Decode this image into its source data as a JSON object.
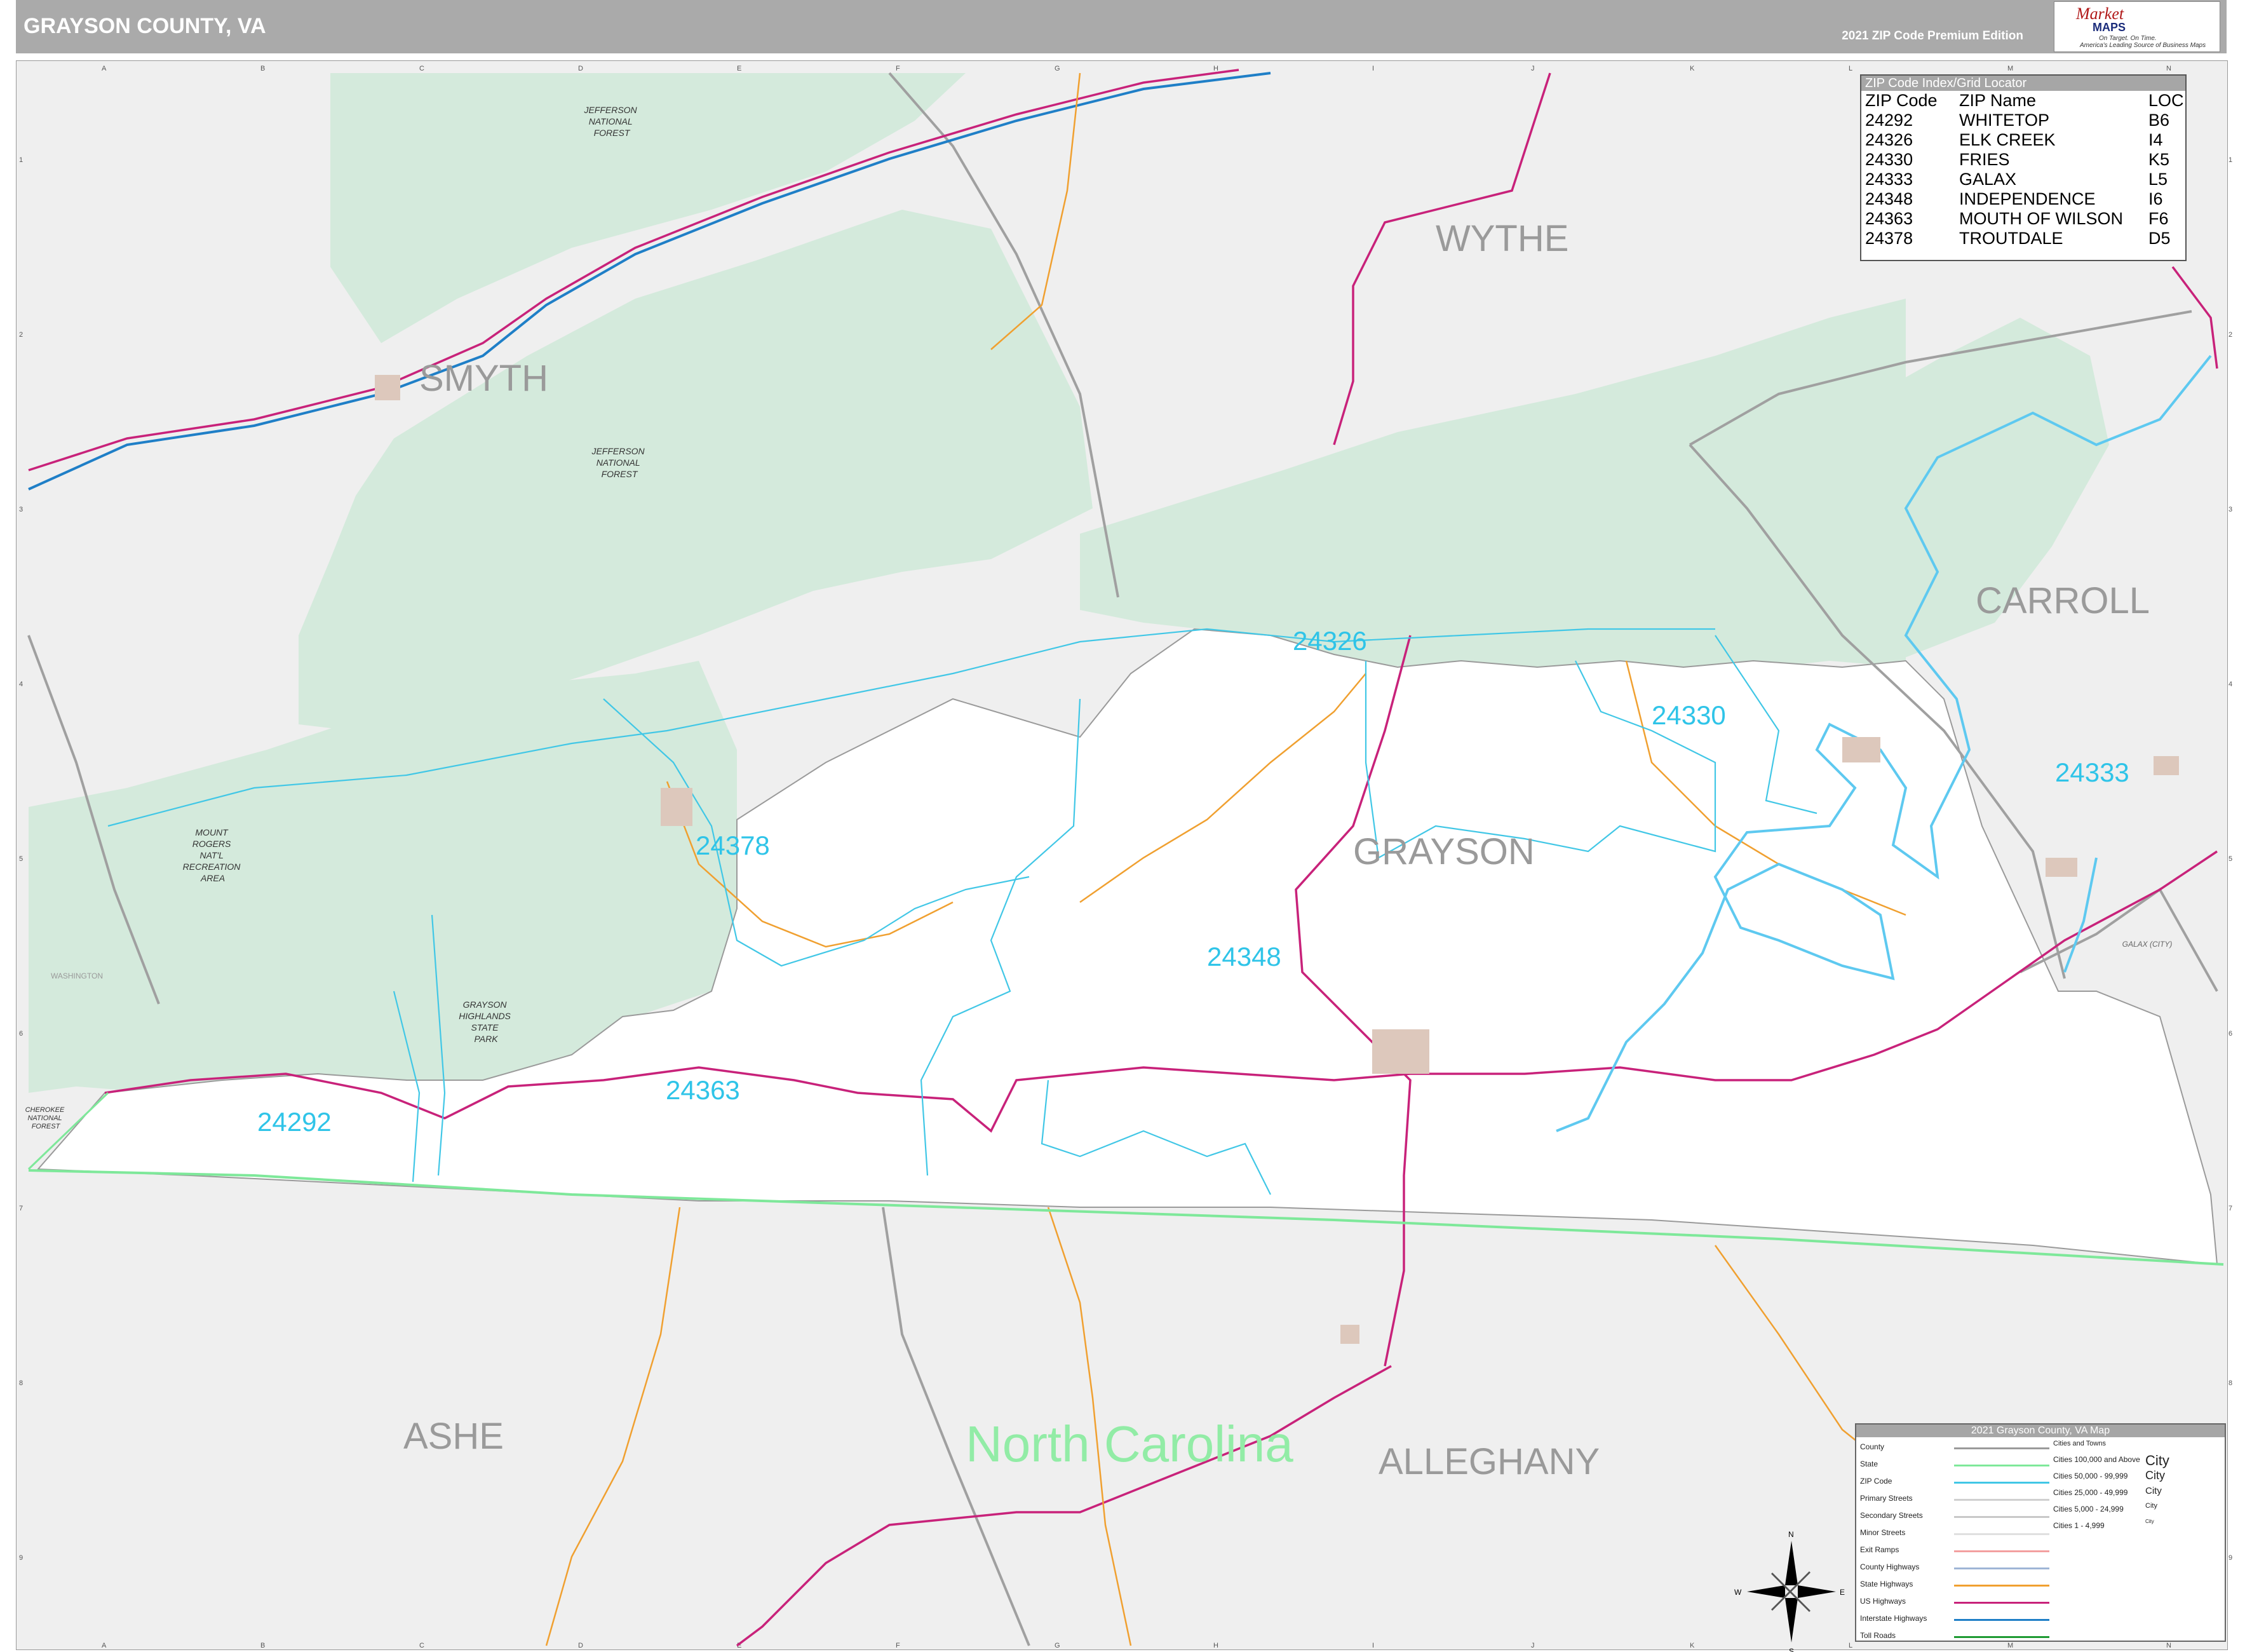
{
  "header": {
    "title": "GRAYSON COUNTY, VA",
    "edition": "2021 ZIP Code Premium Edition",
    "logo": {
      "brand_top": "Market",
      "brand_bottom": "MAPS",
      "tagline_1": "On Target. On Time.",
      "tagline_2": "America's Leading Source of Business Maps"
    }
  },
  "grid": {
    "columns": [
      "A",
      "B",
      "C",
      "D",
      "E",
      "F",
      "G",
      "H",
      "I",
      "J",
      "K",
      "L",
      "M",
      "N"
    ],
    "rows": [
      "1",
      "2",
      "3",
      "4",
      "5",
      "6",
      "7",
      "8",
      "9"
    ]
  },
  "zip_index": {
    "title": "ZIP Code Index/Grid Locator",
    "columns": [
      "ZIP Code",
      "ZIP Name",
      "LOC"
    ],
    "rows": [
      [
        "24292",
        "WHITETOP",
        "B6"
      ],
      [
        "24326",
        "ELK CREEK",
        "I4"
      ],
      [
        "24330",
        "FRIES",
        "K5"
      ],
      [
        "24333",
        "GALAX",
        "L5"
      ],
      [
        "24348",
        "INDEPENDENCE",
        "I6"
      ],
      [
        "24363",
        "MOUTH OF WILSON",
        "F6"
      ],
      [
        "24378",
        "TROUTDALE",
        "D5"
      ]
    ]
  },
  "counties": {
    "grayson": "GRAYSON",
    "wythe": "WYTHE",
    "smyth": "SMYTH",
    "carroll": "CARROLL",
    "ashe": "ASHE",
    "alleghany": "ALLEGHANY",
    "washington": "WASHINGTON",
    "state_nc": "North Carolina"
  },
  "zip_labels": {
    "z24326": "24326",
    "z24330": "24330",
    "z24333": "24333",
    "z24378": "24378",
    "z24348": "24348",
    "z24363": "24363",
    "z24292": "24292"
  },
  "features": {
    "jefferson_forest_1": [
      "JEFFERSON",
      "NATIONAL",
      "FOREST"
    ],
    "jefferson_forest_2": [
      "JEFFERSON",
      "NATIONAL",
      "FOREST"
    ],
    "mount_rogers": [
      "MOUNT",
      "ROGERS",
      "NAT'L",
      "RECREATION",
      "AREA"
    ],
    "grayson_highlands": [
      "GRAYSON",
      "HIGHLANDS",
      "STATE",
      "PARK"
    ],
    "cherokee_forest": [
      "CHEROKEE",
      "NATIONAL",
      "FOREST"
    ],
    "galax_city": "GALAX (CITY)"
  },
  "legend": {
    "title": "2021 Grayson County, VA Map",
    "items": [
      {
        "label": "County",
        "color": "#9a9a9a"
      },
      {
        "label": "State",
        "color": "#7ee89a"
      },
      {
        "label": "ZIP Code",
        "color": "#41c7e6"
      },
      {
        "label": "Primary Streets",
        "color": "#d0d0d0"
      },
      {
        "label": "Secondary Streets",
        "color": "#c8c8c8"
      },
      {
        "label": "Minor Streets",
        "color": "#e0e0e0"
      },
      {
        "label": "Exit Ramps",
        "color": "#f3a0a0"
      },
      {
        "label": "County Highways",
        "color": "#9fb5d6"
      },
      {
        "label": "State Highways",
        "color": "#f0a030"
      },
      {
        "label": "US Highways",
        "color": "#c8227a"
      },
      {
        "label": "Interstate Highways",
        "color": "#1f7fc7"
      },
      {
        "label": "Toll Roads",
        "color": "#1e9a32"
      }
    ],
    "cities_title": "Cities and Towns",
    "cities": [
      {
        "label": "Cities 100,000 and Above",
        "sample": "City"
      },
      {
        "label": "Cities 50,000 - 99,999",
        "sample": "City"
      },
      {
        "label": "Cities 25,000 - 49,999",
        "sample": "City"
      },
      {
        "label": "Cities 5,000 - 24,999",
        "sample": "City"
      },
      {
        "label": "Cities 1 - 4,999",
        "sample": "City"
      }
    ]
  },
  "compass": {
    "n": "N",
    "s": "S",
    "e": "E",
    "w": "W"
  },
  "colors": {
    "forest": "#d4eadc",
    "county_fill": "#ffffff",
    "outside": "#efefef",
    "zip_line": "#41c7e6",
    "zip_label": "#2fc4e8",
    "us_highway": "#c8227a",
    "state_highway": "#f0a030",
    "interstate": "#1f7fc7",
    "state_line": "#7ee89a",
    "river": "#5ec9f0"
  }
}
